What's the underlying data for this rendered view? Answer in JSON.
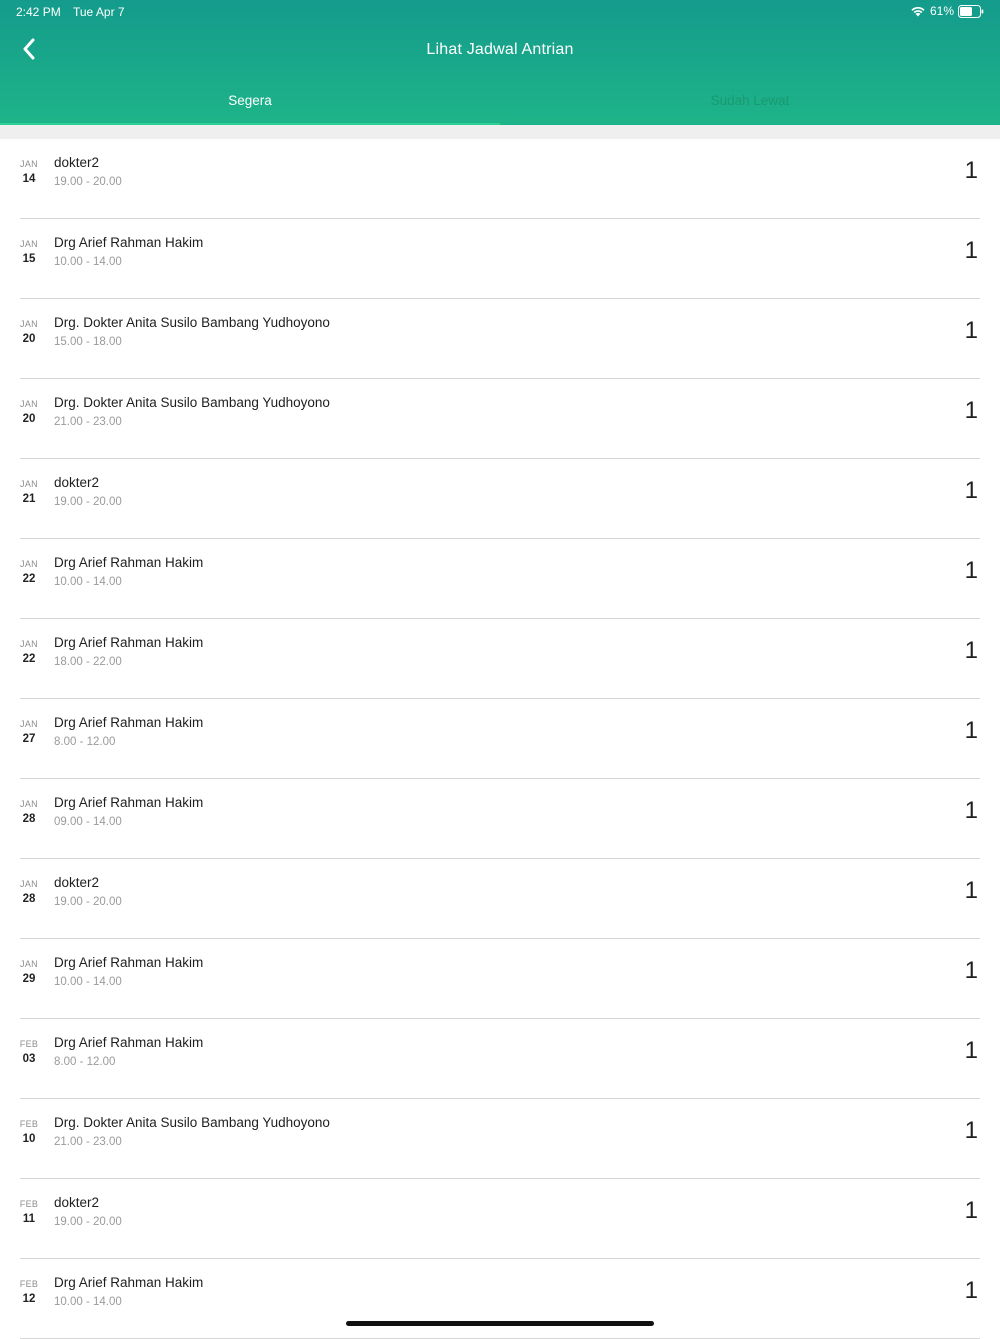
{
  "status_bar": {
    "time": "2:42 PM",
    "date": "Tue Apr 7",
    "battery": "61%"
  },
  "header": {
    "title": "Lihat Jadwal Antrian",
    "back_icon": "chevron-left-icon"
  },
  "tabs": [
    {
      "label": "Segera",
      "active": true
    },
    {
      "label": "Sudah Lewat",
      "active": false
    }
  ],
  "colors": {
    "header_top": "#149b8c",
    "header_bottom": "#1eb489",
    "tab_indicator": "#2ccf94"
  },
  "appointments": [
    {
      "month": "JAN",
      "day": "14",
      "doctor": "dokter2",
      "time": "19.00 - 20.00",
      "queue": "1"
    },
    {
      "month": "JAN",
      "day": "15",
      "doctor": "Drg Arief Rahman Hakim",
      "time": "10.00 - 14.00",
      "queue": "1"
    },
    {
      "month": "JAN",
      "day": "20",
      "doctor": "Drg. Dokter Anita Susilo Bambang Yudhoyono",
      "time": "15.00 - 18.00",
      "queue": "1"
    },
    {
      "month": "JAN",
      "day": "20",
      "doctor": "Drg. Dokter Anita Susilo Bambang Yudhoyono",
      "time": "21.00 - 23.00",
      "queue": "1"
    },
    {
      "month": "JAN",
      "day": "21",
      "doctor": "dokter2",
      "time": "19.00 - 20.00",
      "queue": "1"
    },
    {
      "month": "JAN",
      "day": "22",
      "doctor": "Drg Arief Rahman Hakim",
      "time": "10.00 - 14.00",
      "queue": "1"
    },
    {
      "month": "JAN",
      "day": "22",
      "doctor": "Drg Arief Rahman Hakim",
      "time": "18.00 - 22.00",
      "queue": "1"
    },
    {
      "month": "JAN",
      "day": "27",
      "doctor": "Drg Arief Rahman Hakim",
      "time": "8.00 - 12.00",
      "queue": "1"
    },
    {
      "month": "JAN",
      "day": "28",
      "doctor": "Drg Arief Rahman Hakim",
      "time": "09.00 - 14.00",
      "queue": "1"
    },
    {
      "month": "JAN",
      "day": "28",
      "doctor": "dokter2",
      "time": "19.00 - 20.00",
      "queue": "1"
    },
    {
      "month": "JAN",
      "day": "29",
      "doctor": "Drg Arief Rahman Hakim",
      "time": "10.00 - 14.00",
      "queue": "1"
    },
    {
      "month": "FEB",
      "day": "03",
      "doctor": "Drg Arief Rahman Hakim",
      "time": "8.00 - 12.00",
      "queue": "1"
    },
    {
      "month": "FEB",
      "day": "10",
      "doctor": "Drg. Dokter Anita Susilo Bambang Yudhoyono",
      "time": "21.00 - 23.00",
      "queue": "1"
    },
    {
      "month": "FEB",
      "day": "11",
      "doctor": "dokter2",
      "time": "19.00 - 20.00",
      "queue": "1"
    },
    {
      "month": "FEB",
      "day": "12",
      "doctor": "Drg Arief Rahman Hakim",
      "time": "10.00 - 14.00",
      "queue": "1"
    }
  ]
}
